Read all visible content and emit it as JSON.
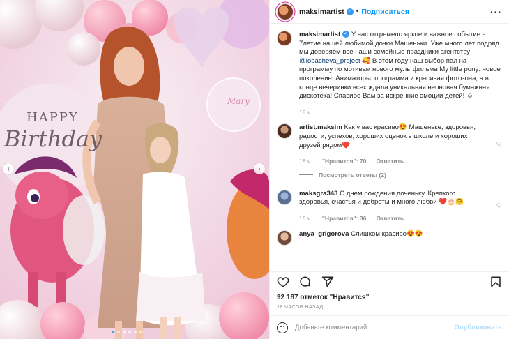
{
  "post": {
    "username": "maksimartist",
    "follow_label": "Подписаться",
    "caption_user": "maksimartist",
    "caption_pre": "У нас отгремело яркое и важное событие - 7летие нашей любимой дочки Машеньки. Уже много лет подряд мы доверяем все наши семейные праздники агентству ",
    "caption_mention": "@lobacheva_project",
    "caption_post": " 🥰 В этом году наш выбор пал на программу по мотивам нового мультфильма My little pony: новое поколение. Аниматоры, программа и красивая фотозона, а в конце вечеринки всех ждала уникальная неоновая бумажная дискотека! Спасибо Вам за искренние эмоции детей! ☺",
    "caption_time": "18 ч."
  },
  "comments": [
    {
      "user": "artist.maksim",
      "text": "Как у вас красиво😍 Машеньке, здоровья, радости, успехов, хороших оценок в школе и хороших друзей рядом❤️",
      "time": "18 ч.",
      "likes": "\"Нравится\": 70",
      "reply": "Ответить",
      "view_replies": "Посмотреть ответы (2)"
    },
    {
      "user": "maksgra343",
      "text": "С днем рождения доченьку. Крепкого здоровья, счастья и доброты и много любви ❤️🎂🤗",
      "time": "18 ч.",
      "likes": "\"Нравится\": 36",
      "reply": "Ответить"
    },
    {
      "user": "anya_grigorova",
      "text": "Слишком красиво😍😍"
    }
  ],
  "photo": {
    "sign_text": "HAPPY",
    "sign_text2": "Birthday",
    "balloon_text": "Mary"
  },
  "footer": {
    "likes": "92 187 отметок \"Нравится\"",
    "ago": "18 ЧАСОВ НАЗАД",
    "comment_placeholder": "Добавьте комментарий...",
    "publish": "Опубликовать"
  },
  "icons": {
    "like": "heart-icon",
    "comment": "comment-icon",
    "share": "share-icon",
    "save": "bookmark-icon",
    "more": "more-options-icon",
    "emoji": "emoji-icon",
    "prev": "chevron-left-icon",
    "next": "chevron-right-icon"
  }
}
